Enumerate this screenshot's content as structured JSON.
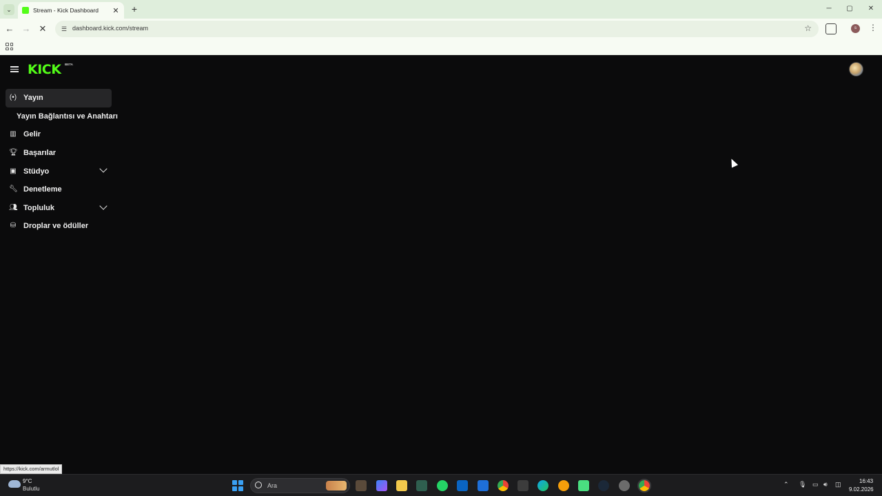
{
  "browser": {
    "tab_title": "Stream - Kick Dashboard",
    "tab_close": "✕",
    "new_tab": "+",
    "url": "dashboard.kick.com/stream",
    "status_url": "https://kick.com/armutlol",
    "profile_initial": "s",
    "window_controls": {
      "minimize": "─",
      "maximize": "▢",
      "close": "✕"
    }
  },
  "kick": {
    "logo_text": "KICK",
    "logo_badge": "BETA",
    "brand_color": "#53fc18",
    "sidebar": {
      "items": [
        {
          "label": "Yayın",
          "icon": "broadcast-icon",
          "active": true
        },
        {
          "label": "Yayın Bağlantısı ve Anahtarı",
          "sub": true
        },
        {
          "label": "Gelir",
          "icon": "chart-icon"
        },
        {
          "label": "Başarılar",
          "icon": "trophy-icon"
        },
        {
          "label": "Stüdyo",
          "icon": "studio-icon",
          "expandable": true
        },
        {
          "label": "Denetleme",
          "icon": "wrench-icon"
        },
        {
          "label": "Topluluk",
          "icon": "community-icon",
          "expandable": true
        },
        {
          "label": "Droplar ve ödüller",
          "icon": "drops-icon"
        }
      ]
    }
  },
  "taskbar": {
    "weather_temp": "9°C",
    "weather_desc": "Bulutlu",
    "search_placeholder": "Ara",
    "time": "16:43",
    "date": "9.02.2026"
  }
}
